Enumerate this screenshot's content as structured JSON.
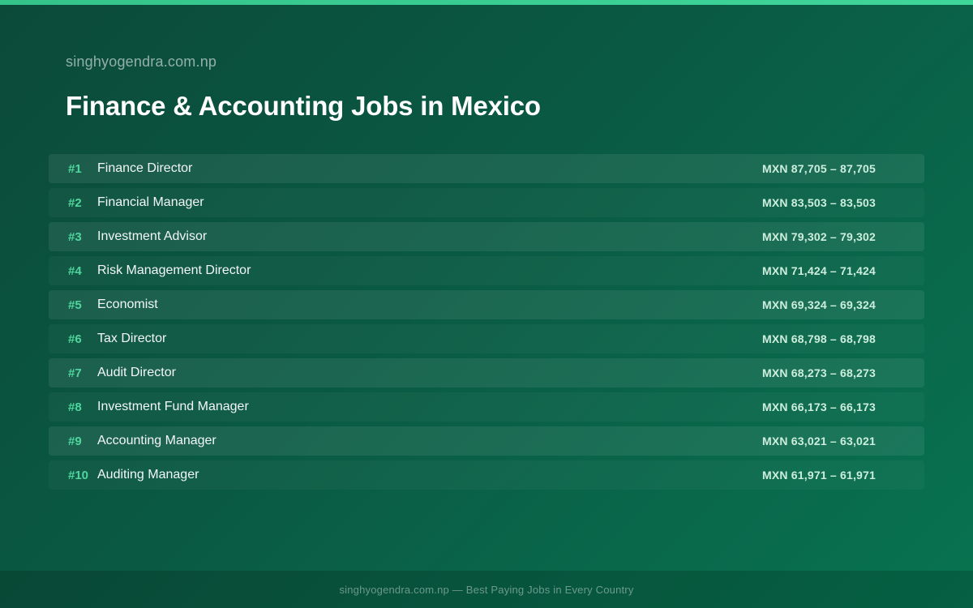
{
  "header": {
    "site": "singhyogendra.com.np",
    "title": "Finance & Accounting Jobs in Mexico"
  },
  "jobs": [
    {
      "rank": "#1",
      "title": "Finance Director",
      "salary": "MXN 87,705 – 87,705"
    },
    {
      "rank": "#2",
      "title": "Financial Manager",
      "salary": "MXN 83,503 – 83,503"
    },
    {
      "rank": "#3",
      "title": "Investment Advisor",
      "salary": "MXN 79,302 – 79,302"
    },
    {
      "rank": "#4",
      "title": "Risk Management Director",
      "salary": "MXN 71,424 – 71,424"
    },
    {
      "rank": "#5",
      "title": "Economist",
      "salary": "MXN 69,324 – 69,324"
    },
    {
      "rank": "#6",
      "title": "Tax Director",
      "salary": "MXN 68,798 – 68,798"
    },
    {
      "rank": "#7",
      "title": "Audit Director",
      "salary": "MXN 68,273 – 68,273"
    },
    {
      "rank": "#8",
      "title": "Investment Fund Manager",
      "salary": "MXN 66,173 – 66,173"
    },
    {
      "rank": "#9",
      "title": "Accounting Manager",
      "salary": "MXN 63,021 – 63,021"
    },
    {
      "rank": "#10",
      "title": "Auditing Manager",
      "salary": "MXN 61,971 – 61,971"
    }
  ],
  "footer": {
    "text": "singhyogendra.com.np — Best Paying Jobs in Every Country"
  },
  "colors": {
    "accent": "#4fd69e",
    "background_start": "#0b4a39",
    "background_end": "#087350"
  }
}
